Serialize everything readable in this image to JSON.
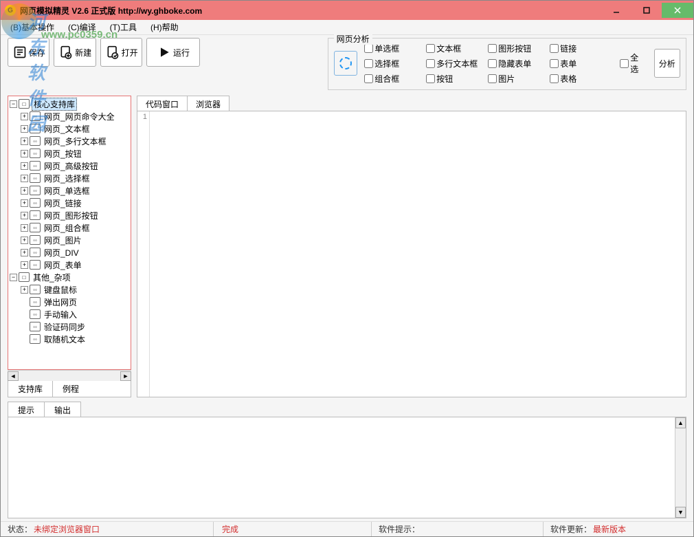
{
  "window": {
    "title": "网页模拟精灵   V2.6 正式版   http://wy.ghboke.com"
  },
  "watermark": {
    "line1": "河东软件园",
    "line2": "www.pc0359.cn"
  },
  "menu": {
    "items": [
      "(B)基本操作",
      "(C)编译",
      "(T)工具",
      "(H)帮助"
    ]
  },
  "toolbar": {
    "save": "保存",
    "new": "新建",
    "open": "打开",
    "run": "运行"
  },
  "analysis": {
    "legend": "网页分析",
    "checks": {
      "c0": "单选框",
      "c1": "文本框",
      "c2": "图形按钮",
      "c3": "链接",
      "c4": "选择框",
      "c5": "多行文本框",
      "c6": "隐藏表单",
      "c7": "表单",
      "c8": "组合框",
      "c9": "按钮",
      "c10": "图片",
      "c11": "表格"
    },
    "all": "全选",
    "analyze_btn": "分析"
  },
  "tree": {
    "root1": "核心支持库",
    "items1": [
      "网页_网页命令大全",
      "网页_文本框",
      "网页_多行文本框",
      "网页_按钮",
      "网页_高级按钮",
      "网页_选择框",
      "网页_单选框",
      "网页_链接",
      "网页_图形按钮",
      "网页_组合框",
      "网页_图片",
      "网页_DIV",
      "网页_表单"
    ],
    "root2": "其他_杂项",
    "items2": [
      "键盘鼠标",
      "弹出网页",
      "手动输入",
      "验证码同步",
      "取随机文本"
    ]
  },
  "left_tabs": {
    "support": "支持库",
    "example": "例程"
  },
  "code_tabs": {
    "code": "代码窗口",
    "browser": "浏览器"
  },
  "gutter": {
    "line1": "1"
  },
  "out_tabs": {
    "hint": "提示",
    "output": "输出"
  },
  "status": {
    "s0_label": "状态：",
    "s0_val": "未绑定浏览器窗口",
    "s1_label": "完成",
    "s2_label": "软件提示：",
    "s3_label": "软件更新：",
    "s3_val": "最新版本"
  }
}
